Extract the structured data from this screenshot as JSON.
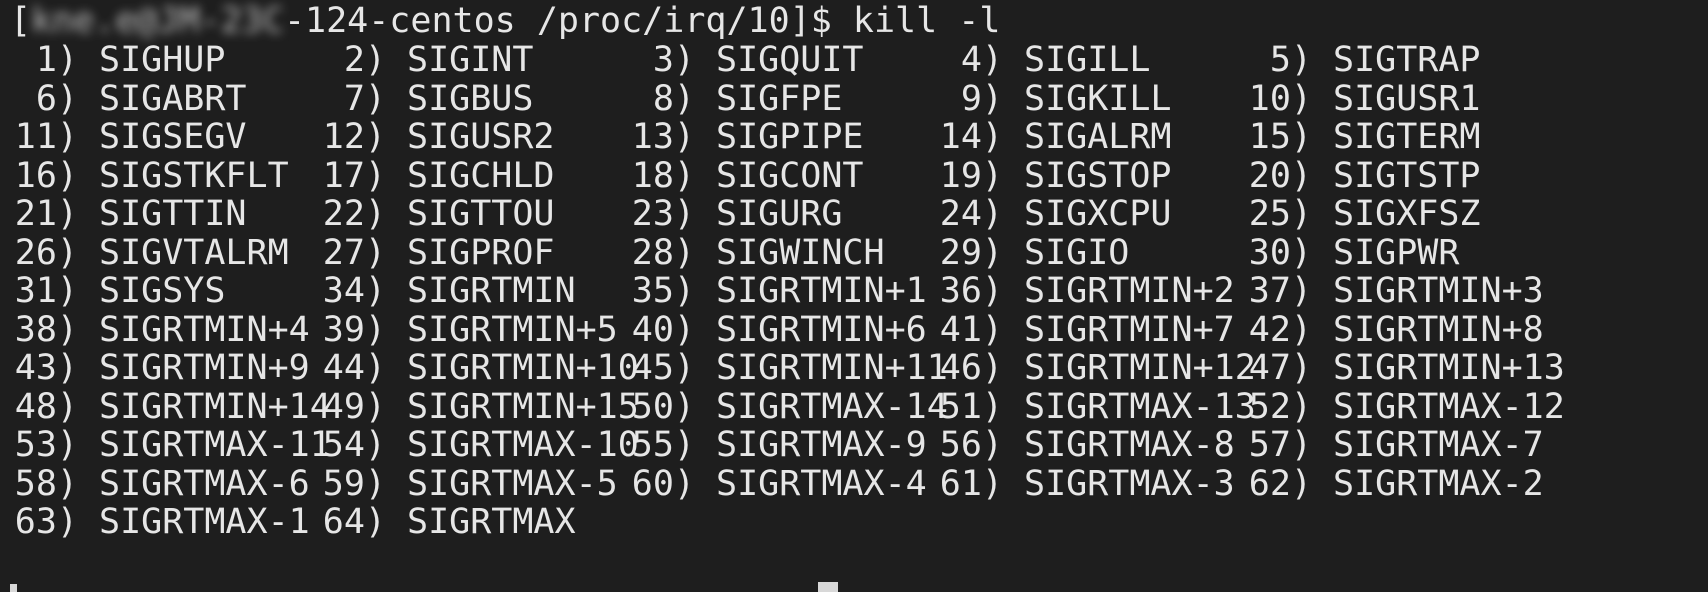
{
  "terminal": {
    "prompt_open": "[",
    "prompt_host_blurred": "kne.e@JM-23C",
    "prompt_rest": "-124-centos /proc/irq/10]$ ",
    "command": "kill -l"
  },
  "rows": [
    [
      [
        "1)",
        "SIGHUP"
      ],
      [
        "2)",
        "SIGINT"
      ],
      [
        "3)",
        "SIGQUIT"
      ],
      [
        "4)",
        "SIGILL"
      ],
      [
        "5)",
        "SIGTRAP"
      ]
    ],
    [
      [
        "6)",
        "SIGABRT"
      ],
      [
        "7)",
        "SIGBUS"
      ],
      [
        "8)",
        "SIGFPE"
      ],
      [
        "9)",
        "SIGKILL"
      ],
      [
        "10)",
        "SIGUSR1"
      ]
    ],
    [
      [
        "11)",
        "SIGSEGV"
      ],
      [
        "12)",
        "SIGUSR2"
      ],
      [
        "13)",
        "SIGPIPE"
      ],
      [
        "14)",
        "SIGALRM"
      ],
      [
        "15)",
        "SIGTERM"
      ]
    ],
    [
      [
        "16)",
        "SIGSTKFLT"
      ],
      [
        "17)",
        "SIGCHLD"
      ],
      [
        "18)",
        "SIGCONT"
      ],
      [
        "19)",
        "SIGSTOP"
      ],
      [
        "20)",
        "SIGTSTP"
      ]
    ],
    [
      [
        "21)",
        "SIGTTIN"
      ],
      [
        "22)",
        "SIGTTOU"
      ],
      [
        "23)",
        "SIGURG"
      ],
      [
        "24)",
        "SIGXCPU"
      ],
      [
        "25)",
        "SIGXFSZ"
      ]
    ],
    [
      [
        "26)",
        "SIGVTALRM"
      ],
      [
        "27)",
        "SIGPROF"
      ],
      [
        "28)",
        "SIGWINCH"
      ],
      [
        "29)",
        "SIGIO"
      ],
      [
        "30)",
        "SIGPWR"
      ]
    ],
    [
      [
        "31)",
        "SIGSYS"
      ],
      [
        "34)",
        "SIGRTMIN"
      ],
      [
        "35)",
        "SIGRTMIN+1"
      ],
      [
        "36)",
        "SIGRTMIN+2"
      ],
      [
        "37)",
        "SIGRTMIN+3"
      ]
    ],
    [
      [
        "38)",
        "SIGRTMIN+4"
      ],
      [
        "39)",
        "SIGRTMIN+5"
      ],
      [
        "40)",
        "SIGRTMIN+6"
      ],
      [
        "41)",
        "SIGRTMIN+7"
      ],
      [
        "42)",
        "SIGRTMIN+8"
      ]
    ],
    [
      [
        "43)",
        "SIGRTMIN+9"
      ],
      [
        "44)",
        "SIGRTMIN+10"
      ],
      [
        "45)",
        "SIGRTMIN+11"
      ],
      [
        "46)",
        "SIGRTMIN+12"
      ],
      [
        "47)",
        "SIGRTMIN+13"
      ]
    ],
    [
      [
        "48)",
        "SIGRTMIN+14"
      ],
      [
        "49)",
        "SIGRTMIN+15"
      ],
      [
        "50)",
        "SIGRTMAX-14"
      ],
      [
        "51)",
        "SIGRTMAX-13"
      ],
      [
        "52)",
        "SIGRTMAX-12"
      ]
    ],
    [
      [
        "53)",
        "SIGRTMAX-11"
      ],
      [
        "54)",
        "SIGRTMAX-10"
      ],
      [
        "55)",
        "SIGRTMAX-9"
      ],
      [
        "56)",
        "SIGRTMAX-8"
      ],
      [
        "57)",
        "SIGRTMAX-7"
      ]
    ],
    [
      [
        "58)",
        "SIGRTMAX-6"
      ],
      [
        "59)",
        "SIGRTMAX-5"
      ],
      [
        "60)",
        "SIGRTMAX-4"
      ],
      [
        "61)",
        "SIGRTMAX-3"
      ],
      [
        "62)",
        "SIGRTMAX-2"
      ]
    ],
    [
      [
        "63)",
        "SIGRTMAX-1"
      ],
      [
        "64)",
        "SIGRTMAX"
      ]
    ]
  ],
  "colors": {
    "background": "#1e1e1e",
    "text": "#e6e6e6"
  }
}
